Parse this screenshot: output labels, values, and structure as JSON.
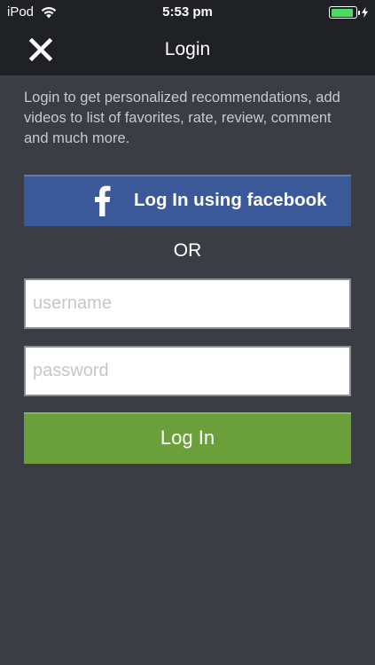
{
  "status_bar": {
    "device": "iPod",
    "time": "5:53 pm",
    "battery_level": 0.9,
    "battery_color": "#4cd964"
  },
  "nav": {
    "title": "Login",
    "close_icon": "close-icon"
  },
  "intro": {
    "text": "Login to get personalized recommendations, add videos to list of favorites, rate, review, comment and much more."
  },
  "facebook": {
    "icon": "facebook-icon",
    "label": "Log In using facebook",
    "color": "#3b5998"
  },
  "divider": {
    "label": "OR"
  },
  "form": {
    "username_placeholder": "username",
    "password_placeholder": "password",
    "username_value": "",
    "password_value": "",
    "submit_label": "Log In",
    "submit_color": "#6a9f3a"
  }
}
